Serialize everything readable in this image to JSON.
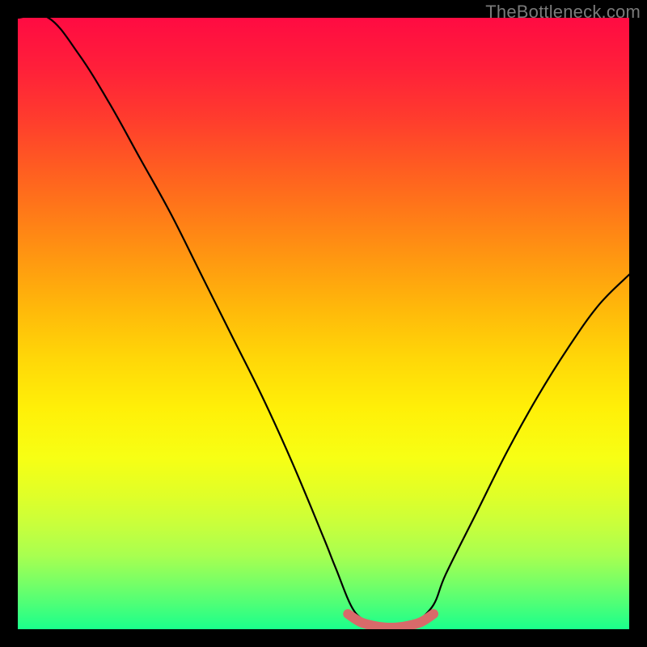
{
  "watermark": "TheBottleneck.com",
  "colors": {
    "frame": "#000000",
    "gradient_top": "#ff0b42",
    "gradient_bottom": "#1aff8c",
    "curve": "#000000",
    "marker": "#d86a6a"
  },
  "chart_data": {
    "type": "line",
    "title": "",
    "xlabel": "",
    "ylabel": "",
    "xlim": [
      0,
      100
    ],
    "ylim": [
      0,
      100
    ],
    "series": [
      {
        "name": "bottleneck-curve",
        "x": [
          0,
          5,
          10,
          15,
          20,
          25,
          30,
          35,
          40,
          45,
          50,
          52,
          55,
          58,
          60,
          63,
          65,
          68,
          70,
          75,
          80,
          85,
          90,
          95,
          100
        ],
        "y": [
          100,
          100,
          94,
          86,
          77,
          68,
          58,
          48,
          38,
          27,
          15,
          10,
          3,
          1,
          0,
          0,
          1,
          4,
          9,
          19,
          29,
          38,
          46,
          53,
          58
        ]
      },
      {
        "name": "optimal-range-marker",
        "x": [
          54,
          56,
          58,
          60,
          62,
          64,
          66,
          68
        ],
        "y": [
          2.5,
          1.2,
          0.6,
          0.3,
          0.3,
          0.6,
          1.2,
          2.5
        ]
      }
    ],
    "annotations": []
  }
}
